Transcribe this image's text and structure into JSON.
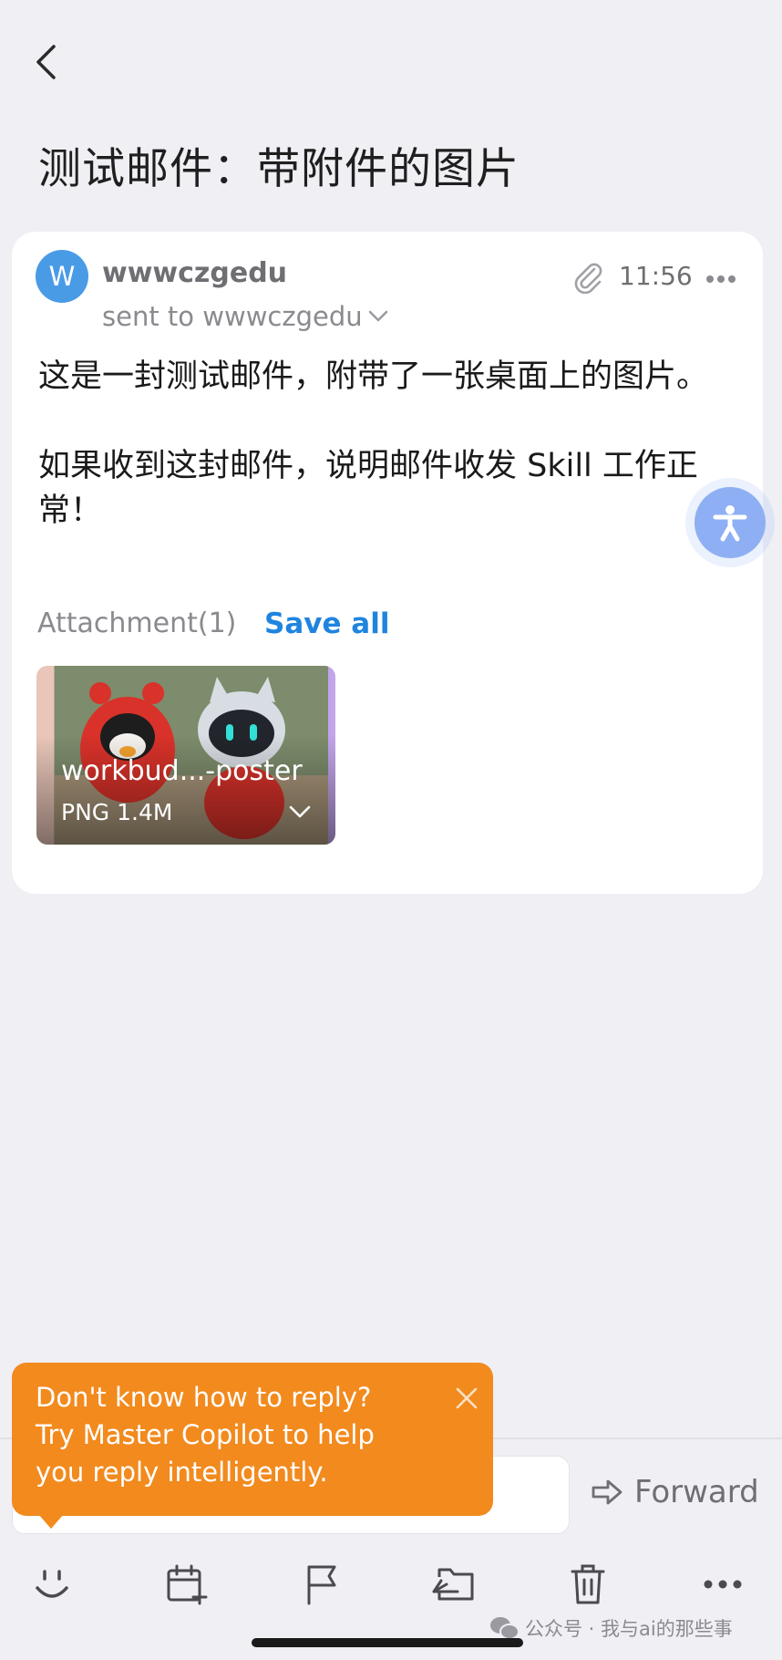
{
  "header": {
    "back_icon": "chevron-left-icon"
  },
  "email": {
    "subject": "测试邮件：带附件的图片",
    "sender_initial": "W",
    "sender_name": "wwwczgedu",
    "recipient_text": "sent to wwwczgedu",
    "time": "11:56",
    "body": "这是一封测试邮件，附带了一张桌面上的图片。\n\n如果收到这封邮件，说明邮件收发 Skill 工作正常！"
  },
  "attachments": {
    "label": "Attachment(1)",
    "save_all": "Save all",
    "items": [
      {
        "name": "workbud...-poster",
        "meta": "PNG 1.4M"
      }
    ]
  },
  "tooltip": {
    "text": "Don't know how to reply?\nTry Master Copilot to help you reply intelligently."
  },
  "actions": {
    "forward_label": "Forward",
    "toolbar_icons": [
      "emoji-icon",
      "calendar-add-icon",
      "flag-icon",
      "move-folder-icon",
      "trash-icon",
      "more-icon"
    ]
  },
  "watermark": "公众号 · 我与ai的那些事",
  "colors": {
    "accent": "#1f84e0",
    "avatar": "#4a9be6",
    "tooltip": "#f28a1e",
    "background": "#efeff4"
  }
}
